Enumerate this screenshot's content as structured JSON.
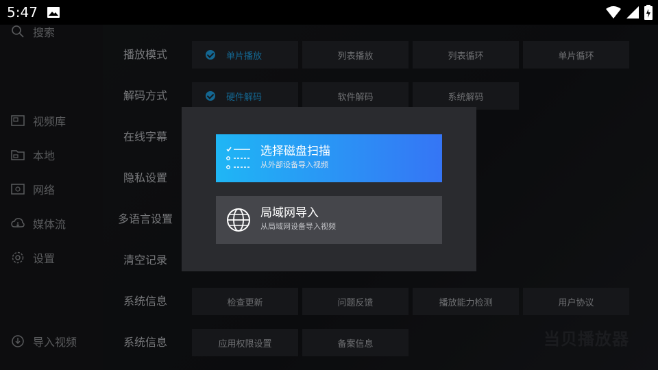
{
  "status": {
    "time": "5:47"
  },
  "sidebar": {
    "search": "搜索",
    "items": [
      {
        "label": "视频库",
        "icon": "video-library-icon"
      },
      {
        "label": "本地",
        "icon": "folder-icon"
      },
      {
        "label": "网络",
        "icon": "network-icon"
      },
      {
        "label": "媒体流",
        "icon": "cloud-icon"
      },
      {
        "label": "设置",
        "icon": "gear-icon"
      }
    ],
    "import": "导入视频"
  },
  "settings": {
    "play_mode": {
      "label": "播放模式",
      "options": [
        "单片播放",
        "列表播放",
        "列表循环",
        "单片循环"
      ],
      "selected": 0
    },
    "decode": {
      "label": "解码方式",
      "options": [
        "硬件解码",
        "软件解码",
        "系统解码"
      ],
      "selected": 0
    },
    "subtitle": {
      "label": "在线字幕"
    },
    "privacy": {
      "label": "隐私设置"
    },
    "language": {
      "label": "多语言设置"
    },
    "clear": {
      "label": "清空记录"
    },
    "sysinfo1": {
      "label": "系统信息",
      "options": [
        "检查更新",
        "问题反馈",
        "播放能力检测",
        "用户协议"
      ]
    },
    "sysinfo2": {
      "label": "系统信息",
      "options": [
        "应用权限设置",
        "备案信息"
      ]
    }
  },
  "watermark": "当贝播放器",
  "modal": {
    "options": [
      {
        "title": "选择磁盘扫描",
        "subtitle": "从外部设备导入视频",
        "icon": "list-scan-icon"
      },
      {
        "title": "局域网导入",
        "subtitle": "从局域网设备导入视频",
        "icon": "globe-icon"
      }
    ]
  },
  "colors": {
    "accent": "#1f9fe0",
    "gradient_start": "#1fb6f5",
    "gradient_end": "#3575f5"
  }
}
